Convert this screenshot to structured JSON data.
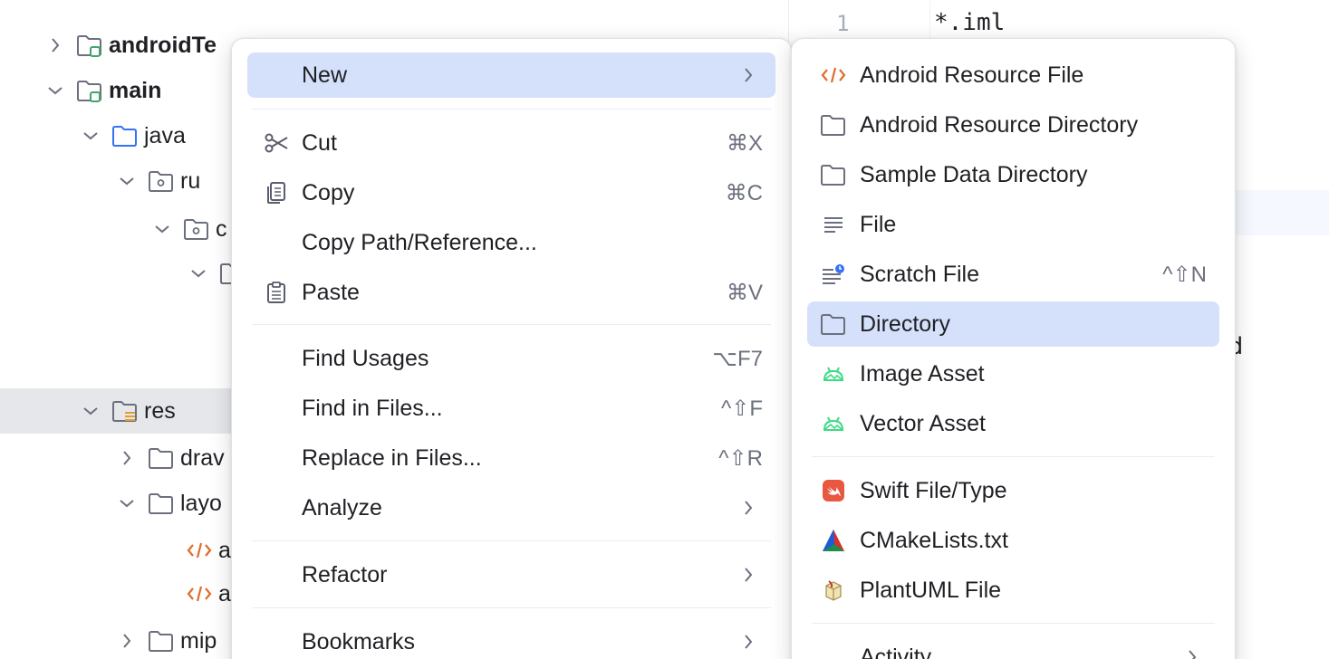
{
  "project_tree": {
    "rows": [
      {
        "label": "androidTe",
        "bold": true
      },
      {
        "label": "main",
        "bold": true
      },
      {
        "label": "java"
      },
      {
        "label": "ru"
      },
      {
        "label": "c"
      },
      {
        "label": ""
      },
      {
        "label": "res"
      },
      {
        "label": "drav"
      },
      {
        "label": "layo"
      },
      {
        "label": "a"
      },
      {
        "label": "a"
      },
      {
        "label": "mip"
      }
    ]
  },
  "editor": {
    "line_number": "1",
    "line_text": "*.iml",
    "fragment": ".d"
  },
  "context_menu": {
    "items": [
      {
        "label": "New"
      },
      {
        "label": "Cut",
        "shortcut": "⌘X"
      },
      {
        "label": "Copy",
        "shortcut": "⌘C"
      },
      {
        "label": "Copy Path/Reference..."
      },
      {
        "label": "Paste",
        "shortcut": "⌘V"
      },
      {
        "label": "Find Usages",
        "shortcut": "⌥F7"
      },
      {
        "label": "Find in Files...",
        "shortcut": "^⇧F"
      },
      {
        "label": "Replace in Files...",
        "shortcut": "^⇧R"
      },
      {
        "label": "Analyze"
      },
      {
        "label": "Refactor"
      },
      {
        "label": "Bookmarks"
      }
    ]
  },
  "new_submenu": {
    "items": [
      {
        "label": "Android Resource File"
      },
      {
        "label": "Android Resource Directory"
      },
      {
        "label": "Sample Data Directory"
      },
      {
        "label": "File"
      },
      {
        "label": "Scratch File",
        "shortcut": "^⇧N"
      },
      {
        "label": "Directory"
      },
      {
        "label": "Image Asset"
      },
      {
        "label": "Vector Asset"
      },
      {
        "label": "Swift File/Type"
      },
      {
        "label": "CMakeLists.txt"
      },
      {
        "label": "PlantUML File"
      },
      {
        "label": "Activity"
      }
    ]
  },
  "colors": {
    "highlight": "#d5e1fb",
    "tree_selection": "#e6e7eb",
    "xml_orange": "#e06c2a",
    "android_green": "#3ddc84",
    "swift_red": "#e8573f"
  }
}
